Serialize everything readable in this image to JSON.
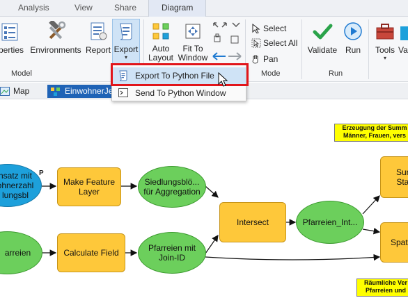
{
  "tabs": [
    "Analysis",
    "View",
    "Share",
    "Diagram"
  ],
  "ribbon": {
    "buttons": {
      "properties": "perties",
      "environments": "Environments",
      "report": "Report",
      "export": "Export",
      "auto_layout": "Auto\nLayout",
      "fit_to_window": "Fit To\nWindow",
      "validate": "Validate",
      "run": "Run",
      "tools": "Tools",
      "partial": "Va"
    },
    "mode_buttons": {
      "select": "Select",
      "select_all": "Select All",
      "pan": "Pan"
    },
    "groups": {
      "model": "Model",
      "mode": "Mode",
      "run": "Run"
    }
  },
  "view_tabs": {
    "map": "Map",
    "model": "EinwohnerJe"
  },
  "export_menu": {
    "items": [
      "Export To Python File",
      "Send To Python Window"
    ]
  },
  "diagram": {
    "nodes": {
      "input_partial": "nsatz mit\nohnerzahl\nlungsbl",
      "parameter_marker": "P",
      "make_feature_layer": "Make Feature\nLayer",
      "siedlungsbloecke": "Siedlungsblö...\nfür Aggregation",
      "intersect": "Intersect",
      "pfarreien_int": "Pfarreien_Int...",
      "sum_partial": "Sur\nSta",
      "pfarreien_partial": "arreien",
      "calculate_field": "Calculate Field",
      "pfarreien_join": "Pfarreien mit\nJoin-ID",
      "spatial_partial": "Spat"
    },
    "notes": {
      "top": "Erzeugung der Summ\nMänner, Frauen, vers",
      "bottom": "Räumliche Ver\nPfarreien und"
    }
  },
  "colors": {
    "tool": "#fec83a",
    "data": "#6ccf5c",
    "input": "#1da0db",
    "highlight_box": "#e1151b",
    "active_view_tab": "#1f63b6"
  }
}
